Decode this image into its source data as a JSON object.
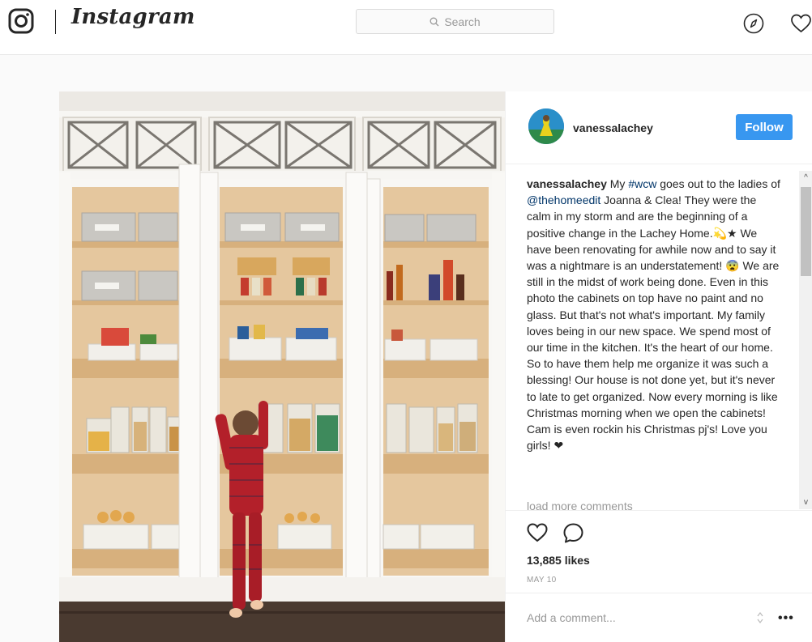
{
  "header": {
    "wordmark": "Instagram",
    "search_placeholder": "Search",
    "icons": [
      "instagram-logo-icon",
      "search-icon",
      "compass-icon",
      "heart-icon"
    ]
  },
  "post": {
    "username": "vanessalachey",
    "follow_label": "Follow",
    "caption": {
      "user": "vanessalachey",
      "part1": " My ",
      "tag1": "#wcw",
      "part2": " goes out to the ladies of ",
      "tag2": "@thehomeedit",
      "part3": " Joanna & Clea! They were the calm in my storm and are the beginning of a positive change in the Lachey Home.💫★ We have been renovating for awhile now and to say it was a nightmare is an understatement! 😨 We are still in the midst of work being done. Even in this photo the cabinets on top have no paint and no glass. But that's not what's important. My family loves being in our new space. We spend most of our time in the kitchen. It's the heart of our home. So to have them help me organize it was such a blessing! Our house is not done yet, but it's never to late to get organized. Now every morning is like Christmas morning when we open the cabinets! Cam is even rockin his Christmas pj's! Love you girls! ❤"
    },
    "load_more": "load more comments",
    "likes": "13,885 likes",
    "date": "MAY 10",
    "comment_placeholder": "Add a comment...",
    "more": "•••"
  },
  "colors": {
    "follow_blue": "#3897f0",
    "tag_blue": "#003569",
    "cabinet_wood": "#e3c499",
    "pajama_red": "#b3202a"
  }
}
